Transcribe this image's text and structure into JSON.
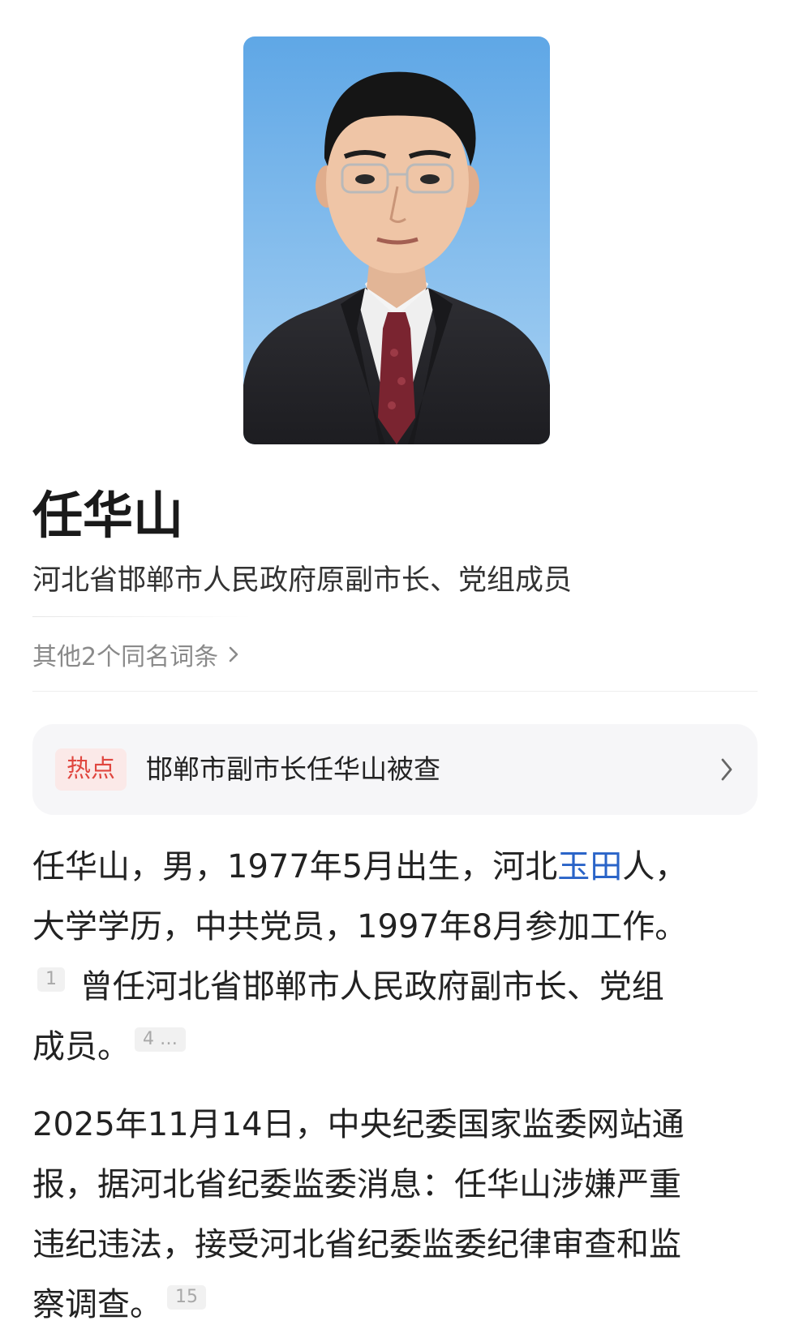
{
  "entry": {
    "name": "任华山",
    "description": "河北省邯郸市人民政府原副市长、党组成员",
    "same_name_link": "其他2个同名词条"
  },
  "hot": {
    "badge": "热点",
    "headline": "邯郸市副市长任华山被查"
  },
  "intro": {
    "line1_part1": "任华山，男，1977年5月出生，河北",
    "line1_link": "玉田",
    "line1_part2": "人，",
    "line2": "大学学历，中共党员，1997年8月参加工作。",
    "ref1": "1",
    "line3": "曾任河北省邯郸市人民政府副市长、党组",
    "line4": "成员。",
    "ref2": "4 …"
  },
  "news": {
    "line1": "2025年11月14日，中央纪委国家监委网站通",
    "line2": "报，据河北省纪委监委消息：任华山涉嫌严重",
    "line3": "违纪违法，接受河北省纪委监委纪律审查和监",
    "line4": "察调查。",
    "ref": "15"
  },
  "colors": {
    "link": "#2a64c8",
    "hot_badge_text": "#e0463f",
    "hot_badge_bg": "#fbe9e8",
    "card_bg": "#f6f6f8",
    "photo_bg": "#6fb0e8"
  },
  "icons": [
    "chevron-right-icon"
  ]
}
